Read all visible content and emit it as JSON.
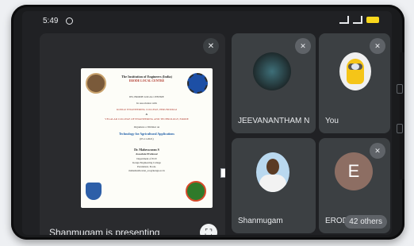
{
  "status_bar": {
    "time": "5:49"
  },
  "presentation": {
    "presenter_label": "Shanmugam is presenting",
    "slide": {
      "line1": "The Institution of Engineers (India)",
      "line2": "ERODE LOCAL CENTRE",
      "line3": "IEI, ERODE LOCAL CENTRE",
      "line4": "In association with",
      "line5": "KONGU ENGINEERING COLLEGE, PERUNDURAI",
      "line6": "&",
      "line7": "VELALAR COLLEGE OF ENGINEERING AND TECHNOLOGY, ERODE",
      "line8": "Organizes a Webinar on",
      "line9": "Technology for Agricultural Applications",
      "line10": "(05.11.2021)",
      "line11": "Dr. Maheswaran S",
      "line12": "Associate Professor",
      "line13": "Department of ECE",
      "line14": "Kongu Engineering College",
      "line15": "Perundurai, Erode.",
      "line16": "mahesheshwaran_ece@kongu.ac.in"
    }
  },
  "participants": [
    {
      "name": "JEEVANANTHAM N"
    },
    {
      "name": "You"
    },
    {
      "name": "Shanmugam"
    },
    {
      "name": "ERODE",
      "initial": "E"
    }
  ],
  "others_count": "42 others"
}
